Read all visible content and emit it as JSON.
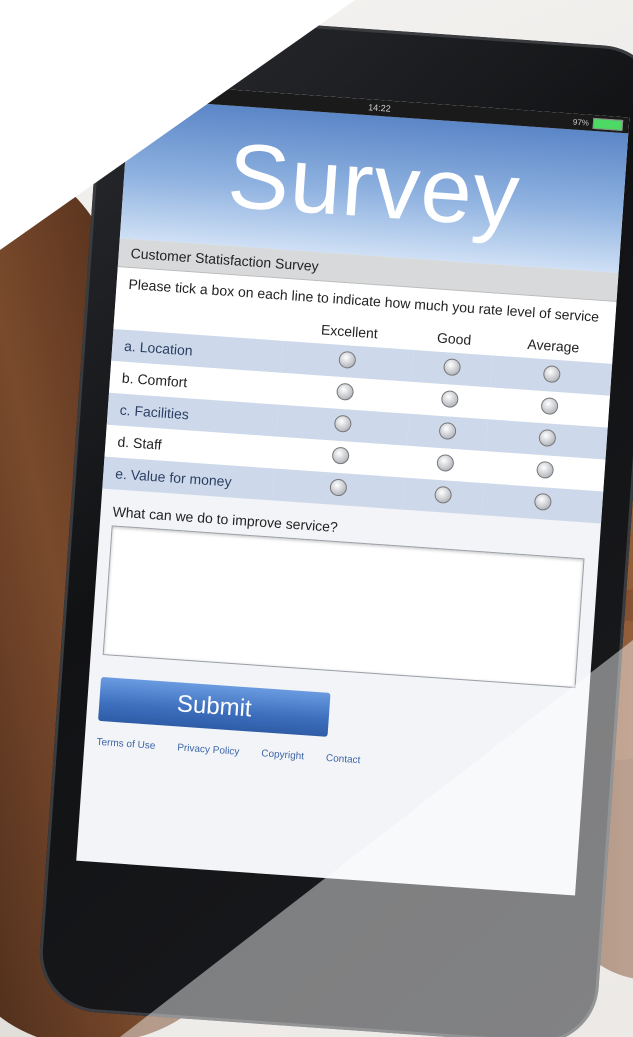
{
  "status_bar": {
    "time": "14:22",
    "battery": "97%"
  },
  "survey": {
    "title": "Survey",
    "subtitle": "Customer Statisfaction Survey",
    "instructions": "Please tick a box on each line to indicate how much you rate level of service",
    "columns": [
      "Excellent",
      "Good",
      "Average"
    ],
    "rows": [
      {
        "label": "a. Location"
      },
      {
        "label": "b. Comfort"
      },
      {
        "label": "c. Facilities"
      },
      {
        "label": "d. Staff"
      },
      {
        "label": "e. Value for money"
      }
    ],
    "improve_label": "What can we do to improve service?",
    "submit_label": "Submit",
    "footer_links": [
      "Terms of Use",
      "Privacy Policy",
      "Copyright",
      "Contact"
    ]
  },
  "colors": {
    "banner_blue": "#5b86c7",
    "row_highlight": "#cdd9ea",
    "submit_blue": "#3d6fbe",
    "battery_green": "#4cd964"
  }
}
